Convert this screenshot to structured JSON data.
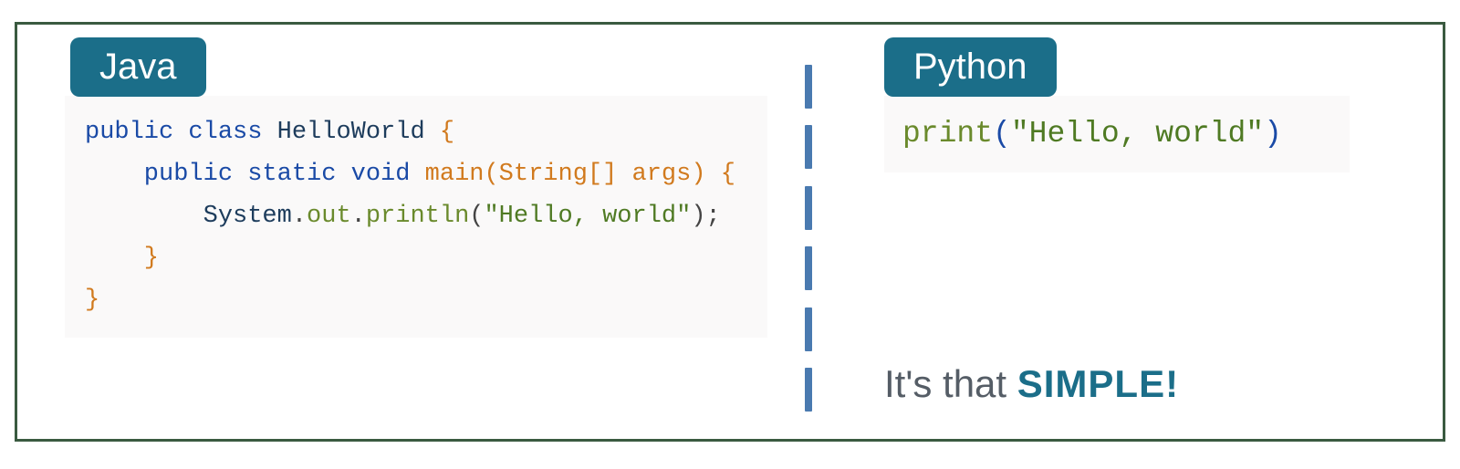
{
  "left": {
    "language": "Java",
    "code": {
      "l1a": "public",
      "l1b": " class ",
      "l1c": "HelloWorld",
      "l1d": " {",
      "l2a": "    public",
      "l2b": " static ",
      "l2c": "void",
      "l2d": " main(String[] args) {",
      "l3a": "        System",
      "l3b": ".",
      "l3c": "out",
      "l3d": ".",
      "l3e": "println",
      "l3f": "(",
      "l3g": "\"Hello, world\"",
      "l3h": ");",
      "l4": "    }",
      "l5": "}"
    }
  },
  "right": {
    "language": "Python",
    "code": {
      "p1a": "print",
      "p1b": "(",
      "p1c": "\"Hello, world\"",
      "p1d": ")"
    },
    "tagline_a": "It's that ",
    "tagline_b": "SIMPLE!"
  }
}
